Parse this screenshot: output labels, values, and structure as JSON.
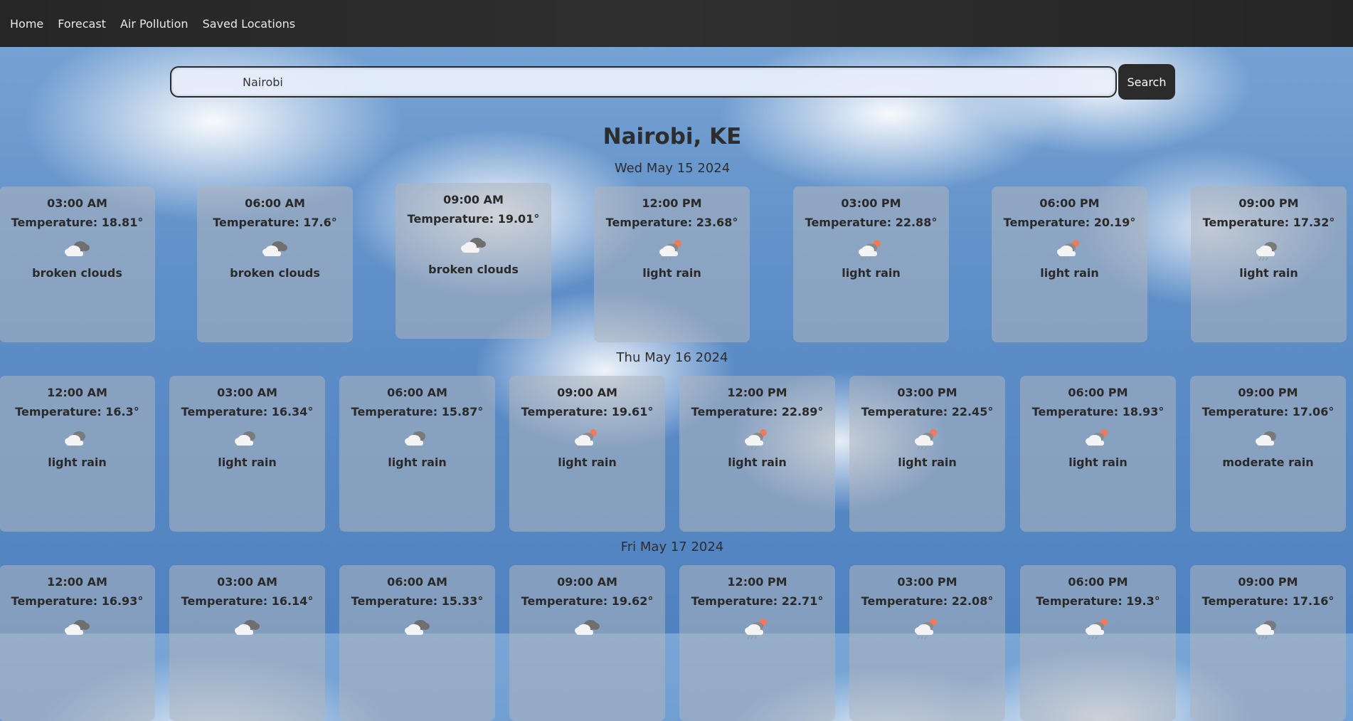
{
  "nav": {
    "home": "Home",
    "forecast": "Forecast",
    "air_pollution": "Air Pollution",
    "saved_locations": "Saved Locations"
  },
  "search": {
    "value": "Nairobi",
    "button": "Search"
  },
  "city": "Nairobi, KE",
  "days": [
    {
      "date": "Wed May 15 2024",
      "slots": [
        {
          "time": "03:00 AM",
          "temp": "Temperature: 18.81°",
          "icon": "broken-clouds-icon",
          "desc": "broken clouds"
        },
        {
          "time": "06:00 AM",
          "temp": "Temperature: 17.6°",
          "icon": "broken-clouds-icon",
          "desc": "broken clouds"
        },
        {
          "time": "09:00 AM",
          "temp": "Temperature: 19.01°",
          "icon": "broken-clouds-icon",
          "desc": "broken clouds"
        },
        {
          "time": "12:00 PM",
          "temp": "Temperature: 23.68°",
          "icon": "rain-sun-icon",
          "desc": "light rain"
        },
        {
          "time": "03:00 PM",
          "temp": "Temperature: 22.88°",
          "icon": "rain-sun-icon",
          "desc": "light rain"
        },
        {
          "time": "06:00 PM",
          "temp": "Temperature: 20.19°",
          "icon": "rain-sun-icon",
          "desc": "light rain"
        },
        {
          "time": "09:00 PM",
          "temp": "Temperature: 17.32°",
          "icon": "rain-cloud-icon",
          "desc": "light rain"
        }
      ]
    },
    {
      "date": "Thu May 16 2024",
      "slots": [
        {
          "time": "12:00 AM",
          "temp": "Temperature: 16.3°",
          "icon": "rain-cloud-icon",
          "desc": "light rain"
        },
        {
          "time": "03:00 AM",
          "temp": "Temperature: 16.34°",
          "icon": "rain-cloud-icon",
          "desc": "light rain"
        },
        {
          "time": "06:00 AM",
          "temp": "Temperature: 15.87°",
          "icon": "rain-cloud-icon",
          "desc": "light rain"
        },
        {
          "time": "09:00 AM",
          "temp": "Temperature: 19.61°",
          "icon": "rain-sun-icon",
          "desc": "light rain"
        },
        {
          "time": "12:00 PM",
          "temp": "Temperature: 22.89°",
          "icon": "rain-sun-icon",
          "desc": "light rain"
        },
        {
          "time": "03:00 PM",
          "temp": "Temperature: 22.45°",
          "icon": "rain-sun-icon",
          "desc": "light rain"
        },
        {
          "time": "06:00 PM",
          "temp": "Temperature: 18.93°",
          "icon": "rain-sun-icon",
          "desc": "light rain"
        },
        {
          "time": "09:00 PM",
          "temp": "Temperature: 17.06°",
          "icon": "rain-cloud-icon",
          "desc": "moderate rain"
        }
      ]
    },
    {
      "date": "Fri May 17 2024",
      "slots": [
        {
          "time": "12:00 AM",
          "temp": "Temperature: 16.93°",
          "icon": "broken-clouds-icon",
          "desc": ""
        },
        {
          "time": "03:00 AM",
          "temp": "Temperature: 16.14°",
          "icon": "broken-clouds-icon",
          "desc": ""
        },
        {
          "time": "06:00 AM",
          "temp": "Temperature: 15.33°",
          "icon": "broken-clouds-icon",
          "desc": ""
        },
        {
          "time": "09:00 AM",
          "temp": "Temperature: 19.62°",
          "icon": "broken-clouds-icon",
          "desc": ""
        },
        {
          "time": "12:00 PM",
          "temp": "Temperature: 22.71°",
          "icon": "rain-sun-icon",
          "desc": ""
        },
        {
          "time": "03:00 PM",
          "temp": "Temperature: 22.08°",
          "icon": "rain-sun-icon",
          "desc": ""
        },
        {
          "time": "06:00 PM",
          "temp": "Temperature: 19.3°",
          "icon": "rain-sun-icon",
          "desc": ""
        },
        {
          "time": "09:00 PM",
          "temp": "Temperature: 17.16°",
          "icon": "rain-cloud-icon",
          "desc": ""
        }
      ]
    }
  ]
}
